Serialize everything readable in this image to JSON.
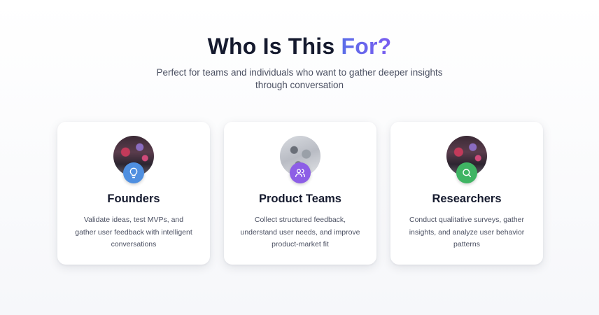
{
  "section": {
    "heading_main": "Who Is This ",
    "heading_accent": "For?",
    "subtitle": "Perfect for teams and individuals who want to gather deeper insights through conversation"
  },
  "cards": [
    {
      "title": "Founders",
      "description": "Validate ideas, test MVPs, and gather user feedback with intelligent conversations",
      "icon": "lightbulb-icon",
      "badge_color": "#4f8fe0"
    },
    {
      "title": "Product Teams",
      "description": "Collect structured feedback, understand user needs, and improve product-market fit",
      "icon": "users-icon",
      "badge_color": "#8d5ee6"
    },
    {
      "title": "Researchers",
      "description": "Conduct qualitative surveys, gather insights, and analyze user behavior patterns",
      "icon": "search-icon",
      "badge_color": "#3fb463"
    }
  ],
  "colors": {
    "accent_start": "#5b6ee8",
    "accent_end": "#7a5cf0",
    "heading": "#151a2e",
    "body_text": "#4c5163"
  }
}
